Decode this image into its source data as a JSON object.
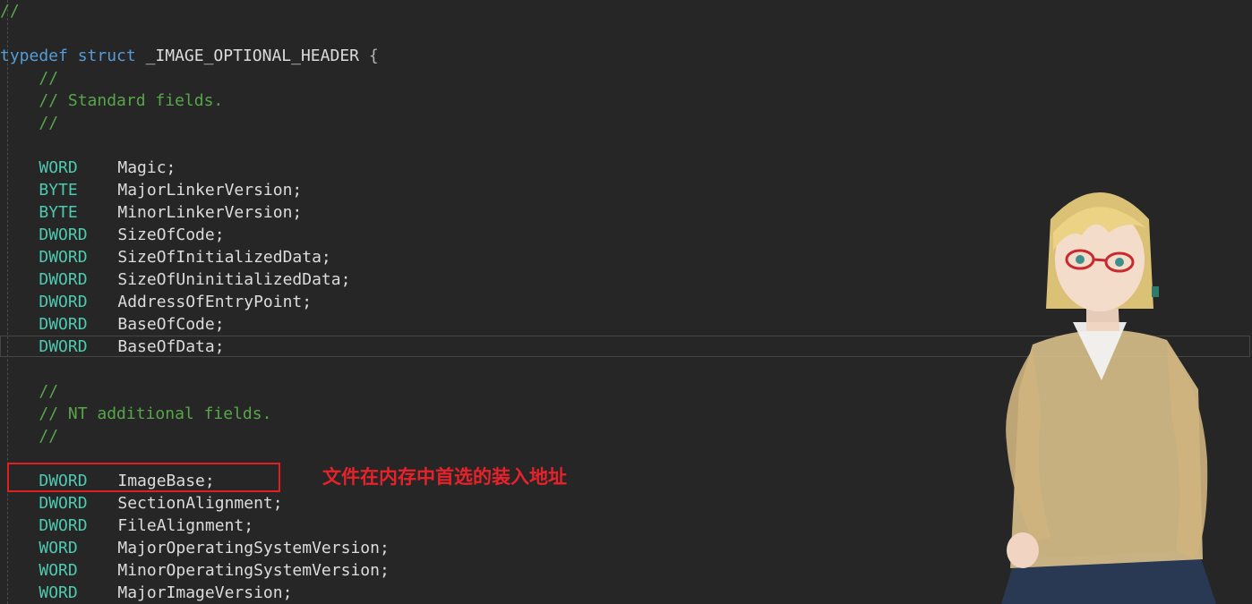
{
  "code_lines": [
    {
      "type_kw": "",
      "name": "",
      "prefix": "//",
      "kind": "comment"
    },
    {
      "type_kw": "",
      "name": "",
      "prefix": "",
      "kind": "blank"
    },
    {
      "kind": "struct",
      "kw1": "typedef",
      "kw2": "struct",
      "ident": "_IMAGE_OPTIONAL_HEADER",
      "brace": "{"
    },
    {
      "kind": "comment",
      "prefix": "//"
    },
    {
      "kind": "comment",
      "prefix": "// Standard fields."
    },
    {
      "kind": "comment",
      "prefix": "//"
    },
    {
      "kind": "blank"
    },
    {
      "kind": "field",
      "type_kw": "WORD",
      "name": "Magic;"
    },
    {
      "kind": "field",
      "type_kw": "BYTE",
      "name": "MajorLinkerVersion;"
    },
    {
      "kind": "field",
      "type_kw": "BYTE",
      "name": "MinorLinkerVersion;"
    },
    {
      "kind": "field",
      "type_kw": "DWORD",
      "name": "SizeOfCode;"
    },
    {
      "kind": "field",
      "type_kw": "DWORD",
      "name": "SizeOfInitializedData;"
    },
    {
      "kind": "field",
      "type_kw": "DWORD",
      "name": "SizeOfUninitializedData;"
    },
    {
      "kind": "field",
      "type_kw": "DWORD",
      "name": "AddressOfEntryPoint;"
    },
    {
      "kind": "field",
      "type_kw": "DWORD",
      "name": "BaseOfCode;"
    },
    {
      "kind": "field",
      "type_kw": "DWORD",
      "name": "BaseOfData;"
    },
    {
      "kind": "blank"
    },
    {
      "kind": "comment",
      "prefix": "//"
    },
    {
      "kind": "comment",
      "prefix": "// NT additional fields."
    },
    {
      "kind": "comment",
      "prefix": "//"
    },
    {
      "kind": "blank"
    },
    {
      "kind": "field",
      "type_kw": "DWORD",
      "name": "ImageBase;"
    },
    {
      "kind": "field",
      "type_kw": "DWORD",
      "name": "SectionAlignment;"
    },
    {
      "kind": "field",
      "type_kw": "DWORD",
      "name": "FileAlignment;"
    },
    {
      "kind": "field",
      "type_kw": "WORD",
      "name": "MajorOperatingSystemVersion;"
    },
    {
      "kind": "field",
      "type_kw": "WORD",
      "name": "MinorOperatingSystemVersion;"
    },
    {
      "kind": "field",
      "type_kw": "WORD",
      "name": "MajorImageVersion;"
    }
  ],
  "annotation": {
    "text": "文件在内存中首选的装入地址",
    "color": "#e8222a"
  },
  "colors": {
    "background": "#262626",
    "comment": "#57a64a",
    "keyword": "#569cd6",
    "type": "#4ec9b0",
    "identifier": "#dcdcdc",
    "highlight_box": "#e02020"
  },
  "wallpaper": {
    "icon": "anime-character-wallpaper-icon"
  }
}
